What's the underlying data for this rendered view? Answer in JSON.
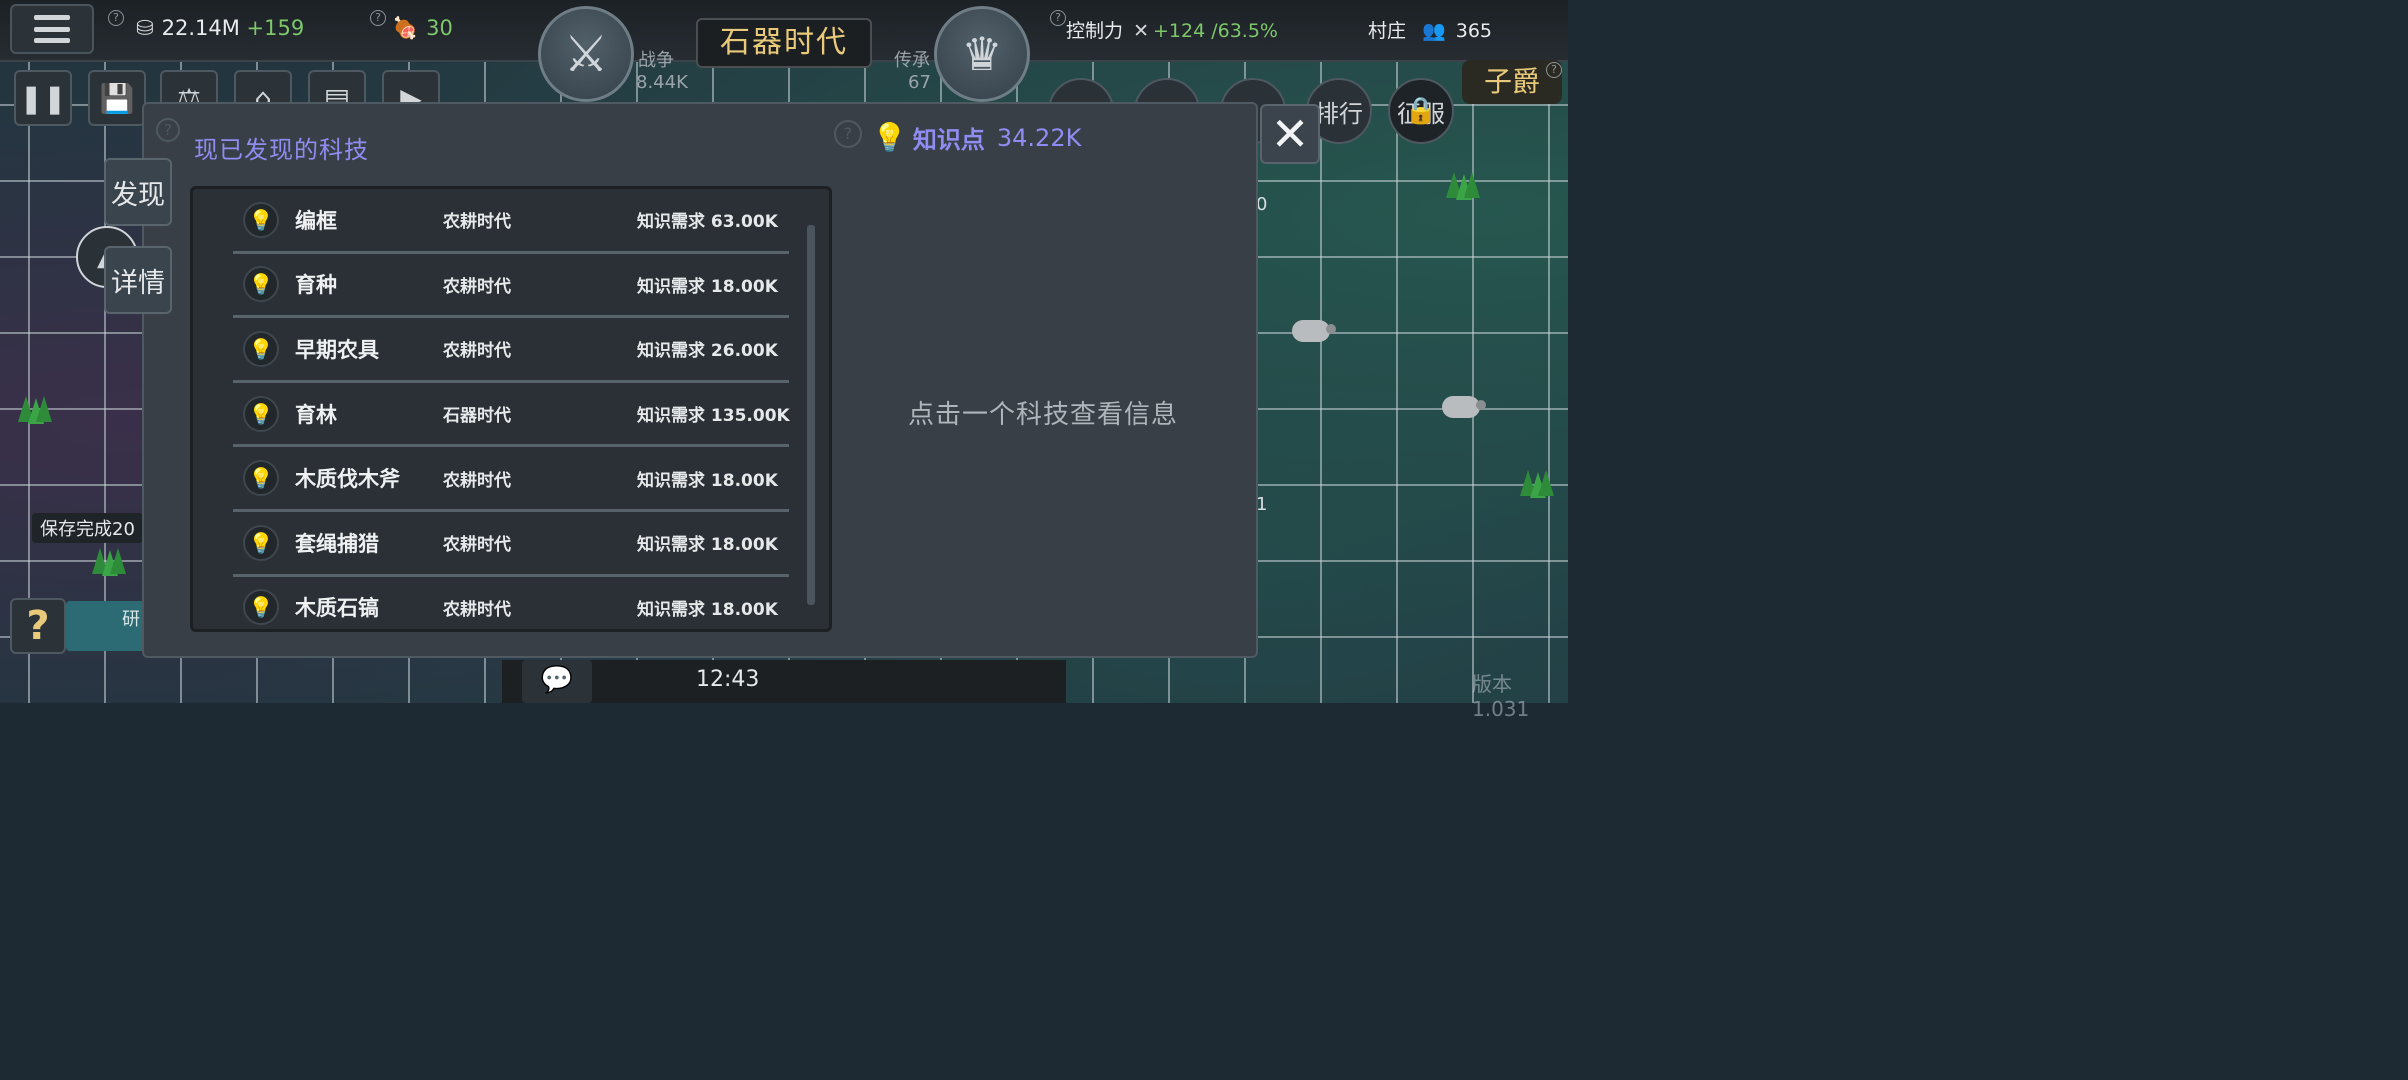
{
  "hud": {
    "wealth": "22.14M",
    "wealth_delta": "+159",
    "food": "30",
    "war_label": "战争",
    "war_value": "8.44K",
    "era": "石器时代",
    "legacy_label": "传承",
    "legacy_value": "67",
    "control_label": "控制力",
    "control_value": "+124 /63.5%",
    "village_label": "村庄",
    "village_value": "365",
    "rank_title": "子爵",
    "circle_ranking": "排行",
    "circle_conquer": "征服"
  },
  "side_tabs": {
    "discover": "发现",
    "details": "详情"
  },
  "save_toast": "保存完成20",
  "research_label": "研",
  "modal": {
    "title": "现已发现的科技",
    "knowledge_label": "知识点",
    "knowledge_value": "34.22K",
    "hint": "点击一个科技查看信息",
    "req_label": "知识需求",
    "techs": [
      {
        "name": "编框",
        "era": "农耕时代",
        "cost": "63.00K"
      },
      {
        "name": "育种",
        "era": "农耕时代",
        "cost": "18.00K"
      },
      {
        "name": "早期农具",
        "era": "农耕时代",
        "cost": "26.00K"
      },
      {
        "name": "育林",
        "era": "石器时代",
        "cost": "135.00K"
      },
      {
        "name": "木质伐木斧",
        "era": "农耕时代",
        "cost": "18.00K"
      },
      {
        "name": "套绳捕猎",
        "era": "农耕时代",
        "cost": "18.00K"
      },
      {
        "name": "木质石镐",
        "era": "农耕时代",
        "cost": "18.00K"
      }
    ]
  },
  "bottom": {
    "clock": "12:43",
    "version": "版本1.031"
  },
  "map_labels": {
    "tile_a": "0",
    "tile_b": "1"
  },
  "colors": {
    "accent": "#8f8cf2",
    "gold": "#e9c97a",
    "green": "#7ec86a",
    "modal_bg": "#383f46"
  }
}
